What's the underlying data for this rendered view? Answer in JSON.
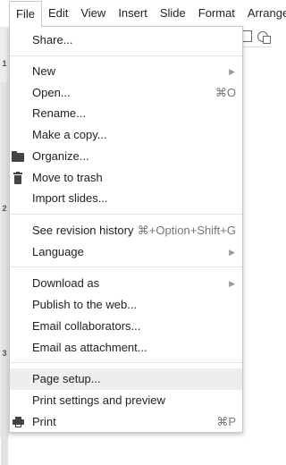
{
  "menubar": {
    "items": [
      "File",
      "Edit",
      "View",
      "Insert",
      "Slide",
      "Format",
      "Arrange"
    ],
    "active_index": 0
  },
  "row_numbers": [
    "1",
    "2",
    "3"
  ],
  "file_menu": {
    "items": [
      {
        "label": "Share...",
        "shortcut": "",
        "submenu": false
      },
      {
        "label": "New",
        "shortcut": "",
        "submenu": true
      },
      {
        "label": "Open...",
        "shortcut": "⌘O",
        "submenu": false
      },
      {
        "label": "Rename...",
        "shortcut": "",
        "submenu": false
      },
      {
        "label": "Make a copy...",
        "shortcut": "",
        "submenu": false
      },
      {
        "label": "Organize...",
        "shortcut": "",
        "submenu": false,
        "icon": "folder-icon"
      },
      {
        "label": "Move to trash",
        "shortcut": "",
        "submenu": false,
        "icon": "trash-icon"
      },
      {
        "label": "Import slides...",
        "shortcut": "",
        "submenu": false
      },
      {
        "label": "See revision history",
        "shortcut": "⌘+Option+Shift+G",
        "submenu": false
      },
      {
        "label": "Language",
        "shortcut": "",
        "submenu": true
      },
      {
        "label": "Download as",
        "shortcut": "",
        "submenu": true
      },
      {
        "label": "Publish to the web...",
        "shortcut": "",
        "submenu": false
      },
      {
        "label": "Email collaborators...",
        "shortcut": "",
        "submenu": false
      },
      {
        "label": "Email as attachment...",
        "shortcut": "",
        "submenu": false
      },
      {
        "label": "Page setup...",
        "shortcut": "",
        "submenu": false,
        "highlighted": true
      },
      {
        "label": "Print settings and preview",
        "shortcut": "",
        "submenu": false
      },
      {
        "label": "Print",
        "shortcut": "⌘P",
        "submenu": false,
        "icon": "print-icon"
      }
    ],
    "submenu_arrow": "▶"
  },
  "colors": {
    "menu_background": "#ffffff",
    "highlight": "#eeeeee",
    "separator": "#e5e5e5",
    "shortcut_text": "#777777"
  }
}
